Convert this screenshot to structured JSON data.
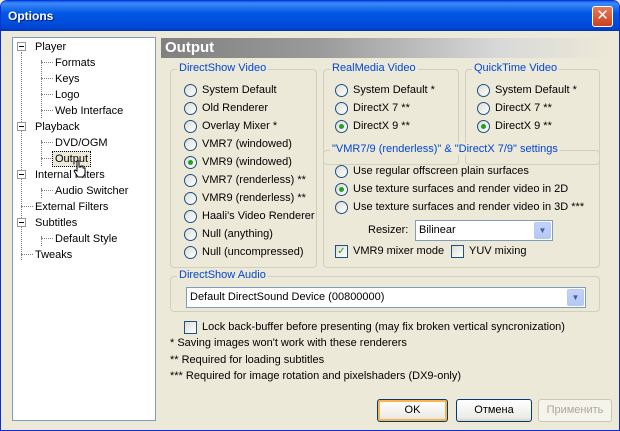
{
  "window": {
    "title": "Options"
  },
  "tree": {
    "player": "Player",
    "formats": "Formats",
    "keys": "Keys",
    "logo": "Logo",
    "web_interface": "Web Interface",
    "playback": "Playback",
    "dvd_ogm": "DVD/OGM",
    "output": "Output",
    "internal_filters": "Internal Filters",
    "audio_switcher": "Audio Switcher",
    "external_filters": "External Filters",
    "subtitles": "Subtitles",
    "default_style": "Default Style",
    "tweaks": "Tweaks"
  },
  "panel": {
    "title": "Output"
  },
  "directshow_video": {
    "title": "DirectShow Video",
    "options": [
      "System Default",
      "Old Renderer",
      "Overlay Mixer *",
      "VMR7 (windowed)",
      "VMR9 (windowed)",
      "VMR7 (renderless) **",
      "VMR9 (renderless) **",
      "Haali's Video Renderer",
      "Null (anything)",
      "Null (uncompressed)"
    ],
    "selected": "VMR9 (windowed)"
  },
  "realmedia_video": {
    "title": "RealMedia Video",
    "options": [
      "System Default *",
      "DirectX 7 **",
      "DirectX 9 **"
    ],
    "selected": "DirectX 9 **"
  },
  "quicktime_video": {
    "title": "QuickTime Video",
    "options": [
      "System Default *",
      "DirectX 7 **",
      "DirectX 9 **"
    ],
    "selected": "DirectX 9 **"
  },
  "vmr_settings": {
    "title": "\"VMR7/9 (renderless)\" & \"DirectX 7/9\" settings",
    "options": [
      "Use regular offscreen plain surfaces",
      "Use texture surfaces and render video in 2D",
      "Use texture surfaces and render video in 3D ***"
    ],
    "selected": "Use texture surfaces and render video in 2D",
    "resizer_label": "Resizer:",
    "resizer_value": "Bilinear",
    "vmr9_mixer_label": "VMR9 mixer mode",
    "vmr9_mixer_checked": true,
    "yuv_mixing_label": "YUV mixing",
    "yuv_mixing_checked": false
  },
  "directshow_audio": {
    "title": "DirectShow Audio",
    "device": "Default DirectSound Device (00800000)"
  },
  "lock_backbuffer": {
    "label": "Lock back-buffer before presenting (may fix broken vertical syncronization)",
    "checked": false
  },
  "notes": [
    "* Saving images won't work with these renderers",
    "** Required for loading subtitles",
    "*** Required for image rotation and pixelshaders (DX9-only)"
  ],
  "buttons": {
    "ok": "OK",
    "cancel": "Отмена",
    "apply": "Применить"
  },
  "colors": {
    "titlebar": "#0058E6",
    "group_title": "#0046D5",
    "radio_dot": "#21A121"
  },
  "icons": {
    "close": "close-icon",
    "dropdown": "chevron-down-icon",
    "cursor": "hand-pointer-icon"
  }
}
